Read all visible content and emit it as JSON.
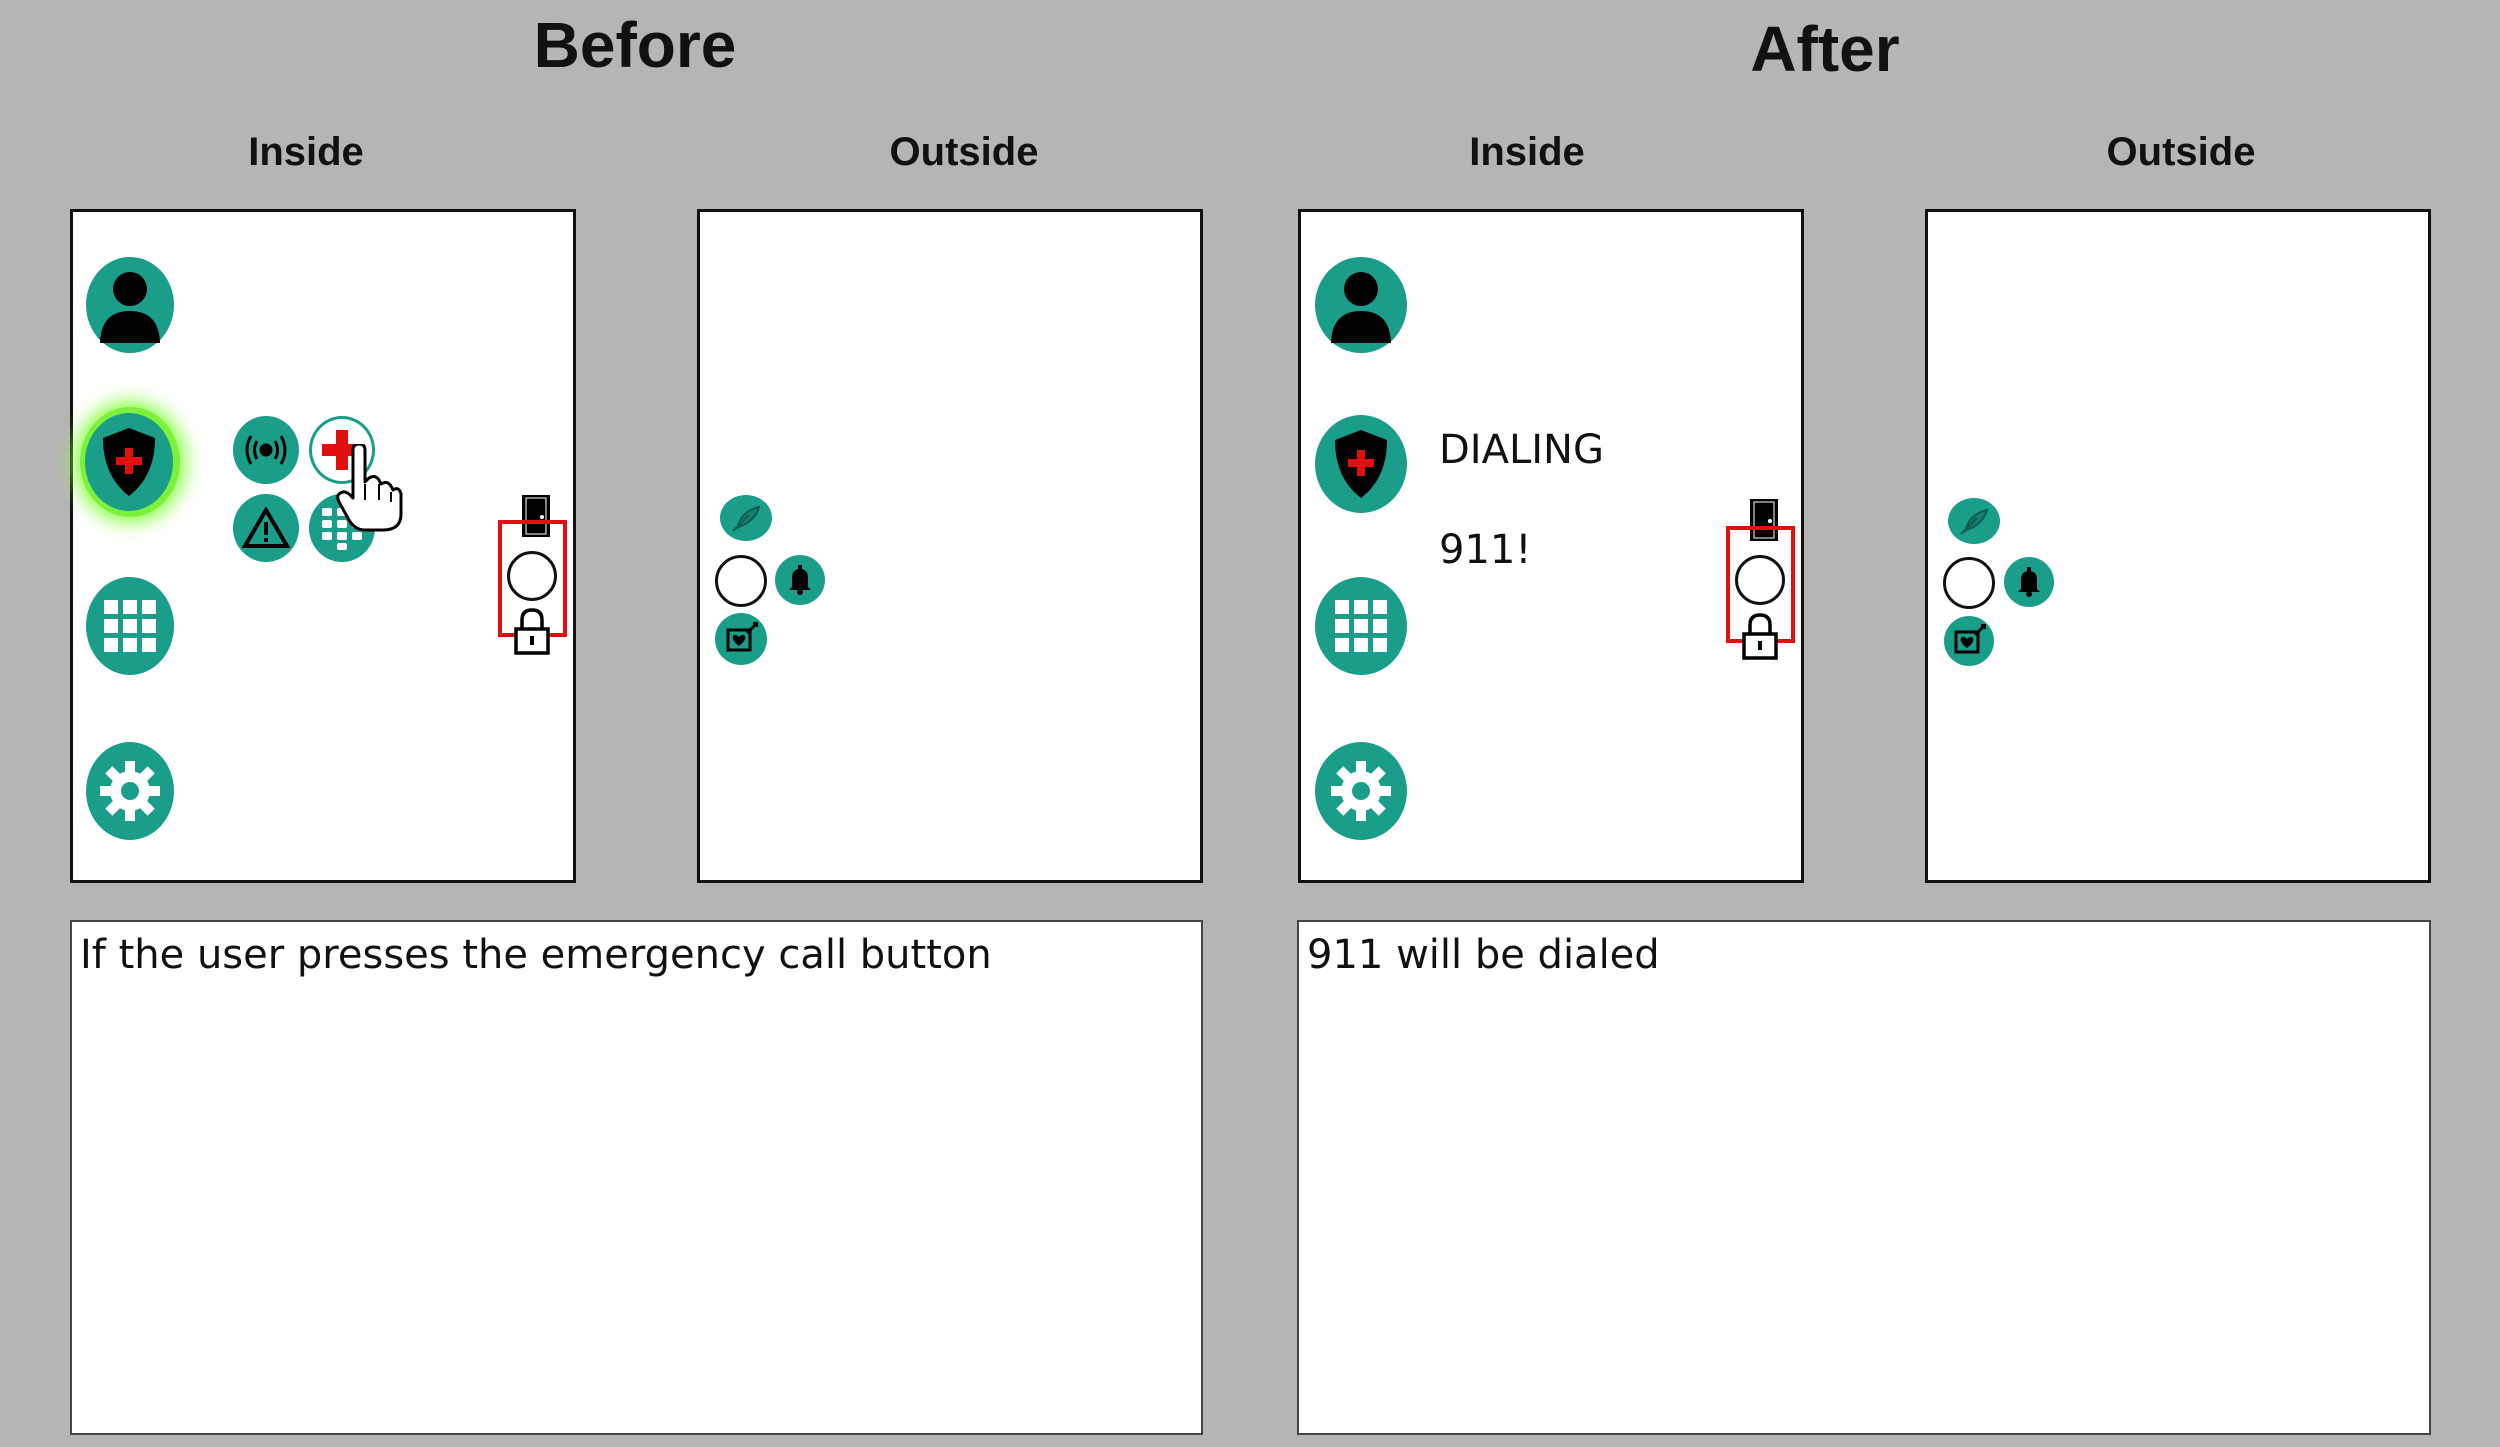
{
  "before": {
    "heading": "Before",
    "inside_label": "Inside",
    "outside_label": "Outside",
    "description": "If the user presses the emergency call button"
  },
  "after": {
    "heading": "After",
    "inside_label": "Inside",
    "outside_label": "Outside",
    "status_line1": "DIALING",
    "status_line2": "911!",
    "description": "911 will be dialed"
  },
  "colors": {
    "background": "#b5b5b5",
    "icon_teal": "#1a9e89",
    "highlight_glow": "#7cf03a",
    "lock_frame_red": "#e01010",
    "emergency_cross_red": "#e01010"
  },
  "icons": {
    "sidebar": [
      "person-icon",
      "shield-cross-icon",
      "apps-grid-icon",
      "gear-icon"
    ],
    "emergency_menu": [
      "radio-signal-icon",
      "medical-cross-icon",
      "warning-icon",
      "keypad-icon"
    ],
    "door_panel": [
      "door-icon",
      "doorbell-ring",
      "padlock-icon"
    ],
    "outside_panel": [
      "feather-icon",
      "bell-icon",
      "heart-message-icon"
    ]
  }
}
